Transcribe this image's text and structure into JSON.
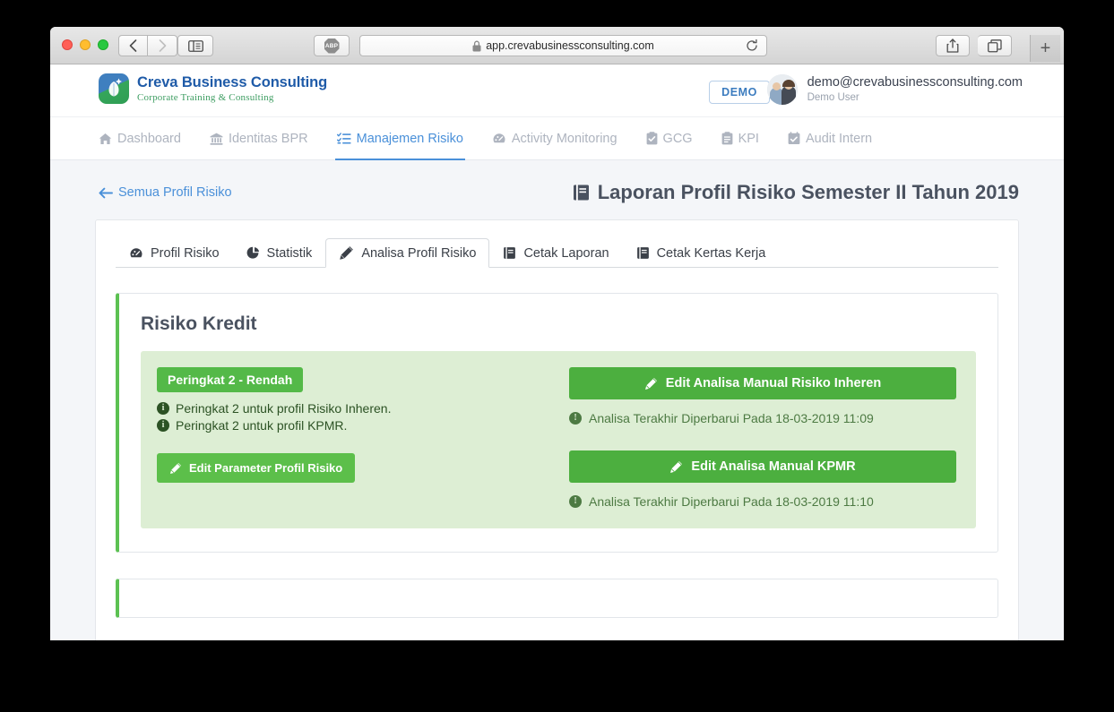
{
  "browser": {
    "url": "app.crevabusinessconsulting.com",
    "lock_icon": "lock-icon",
    "back_icon": "chevron-left-icon",
    "forward_icon": "chevron-right-icon",
    "sidebar_icon": "sidebar-toggle-icon",
    "adblock_label": "ABP",
    "reload_icon": "reload-icon",
    "share_icon": "share-icon",
    "tabs_icon": "show-tabs-icon",
    "newtab_label": "+"
  },
  "header": {
    "logo_title": "Creva Business Consulting",
    "logo_subtitle": "Corporate Training & Consulting",
    "demo_badge": "DEMO",
    "user_email": "demo@crevabusinessconsulting.com",
    "user_name": "Demo User"
  },
  "nav": {
    "items": [
      {
        "label": "Dashboard",
        "icon": "home-icon",
        "active": false
      },
      {
        "label": "Identitas BPR",
        "icon": "bank-icon",
        "active": false
      },
      {
        "label": "Manajemen Risiko",
        "icon": "tasks-list-icon",
        "active": true
      },
      {
        "label": "Activity Monitoring",
        "icon": "gauge-icon",
        "active": false
      },
      {
        "label": "GCG",
        "icon": "clipboard-check-icon",
        "active": false
      },
      {
        "label": "KPI",
        "icon": "clipboard-list-icon",
        "active": false
      },
      {
        "label": "Audit Intern",
        "icon": "calendar-check-icon",
        "active": false
      }
    ]
  },
  "page": {
    "back_label": "Semua Profil Risiko",
    "back_icon": "arrow-left-icon",
    "title": "Laporan Profil Risiko Semester II Tahun 2019",
    "title_icon": "book-icon"
  },
  "tabs": [
    {
      "label": "Profil Risiko",
      "icon": "gauge-icon",
      "active": false
    },
    {
      "label": "Statistik",
      "icon": "pie-chart-icon",
      "active": false
    },
    {
      "label": "Analisa Profil Risiko",
      "icon": "pencil-icon",
      "active": true
    },
    {
      "label": "Cetak Laporan",
      "icon": "book-icon",
      "active": false
    },
    {
      "label": "Cetak Kertas Kerja",
      "icon": "book-icon",
      "active": false
    }
  ],
  "risk_card": {
    "title": "Risiko Kredit",
    "rank_badge": "Peringkat 2 - Rendah",
    "notes": [
      "Peringkat 2 untuk profil Risiko Inheren.",
      "Peringkat 2 untuk profil KPMR."
    ],
    "edit_parameter_label": "Edit Parameter Profil Risiko",
    "edit_inheren_label": "Edit Analisa Manual Risiko Inheren",
    "inheren_timestamp": "Analisa Terakhir Diperbarui Pada 18-03-2019 11:09",
    "edit_kpmr_label": "Edit Analisa Manual KPMR",
    "kpmr_timestamp": "Analisa Terakhir Diperbarui Pada 18-03-2019 11:10",
    "pencil_icon": "pencil-icon",
    "info_icon": "info-circle-icon",
    "alert_icon": "exclamation-circle-icon"
  },
  "colors": {
    "accent_blue": "#4a90d9",
    "brand_blue": "#1f5ba8",
    "brand_green": "#3f9e63",
    "success_green": "#54b948",
    "button_green": "#4caf3f",
    "panel_green": "#ddeed4",
    "panel_text_green": "#2c5224",
    "page_bg": "#f4f6f9"
  }
}
